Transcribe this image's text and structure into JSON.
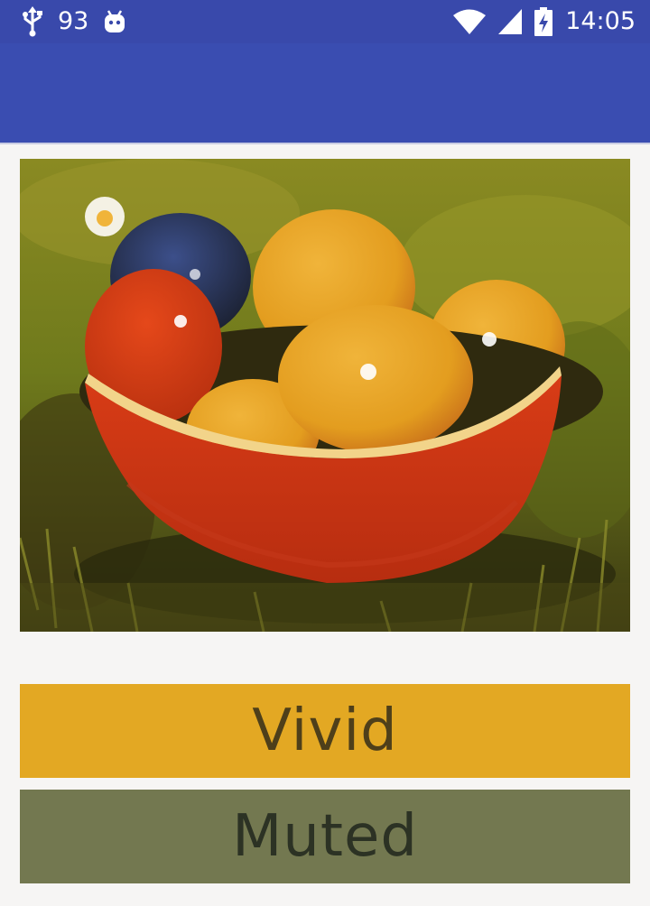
{
  "status_bar": {
    "notification_count": "93",
    "time": "14:05",
    "icons": [
      "usb-icon",
      "android-icon",
      "wifi-icon",
      "cellular-signal-icon",
      "battery-charging-icon"
    ]
  },
  "image": {
    "subject": "bowl of dyed eggs on grass"
  },
  "swatches": [
    {
      "label": "Vivid",
      "background": "#e3a823",
      "text_color": "#4e3f1a"
    },
    {
      "label": "Muted",
      "background": "#737850",
      "text_color": "#2c3224"
    }
  ],
  "colors": {
    "status_bar": "#3949ab",
    "app_bar": "#3a4db1",
    "background": "#f6f5f4"
  }
}
